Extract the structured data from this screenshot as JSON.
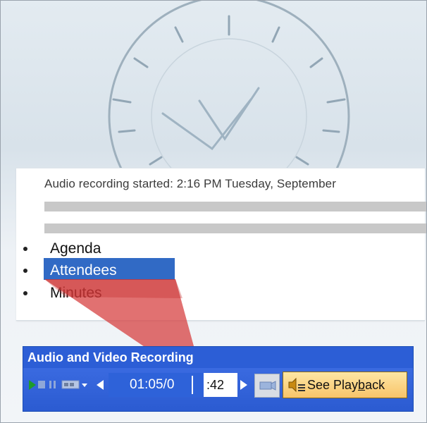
{
  "note": {
    "status_text": "Audio recording started: 2:16 PM Tuesday, September",
    "bullets": [
      {
        "label": "Agenda",
        "selected": false
      },
      {
        "label": "Attendees",
        "selected": true
      },
      {
        "label": "Minutes",
        "selected": false
      }
    ]
  },
  "toolbar": {
    "title": "Audio and Video Recording",
    "time_main": "01:05/0",
    "time_suffix": ":42",
    "playback_prefix": "See Play",
    "playback_accel": "b",
    "playback_suffix": "ack",
    "icons": {
      "play": "play-icon",
      "stop": "stop-icon",
      "pause": "pause-icon",
      "record": "record-menu-icon",
      "rewind": "rewind-icon",
      "forward": "forward-icon",
      "video": "video-icon",
      "playback": "speaker-notes-icon"
    }
  },
  "colors": {
    "selection": "#316ac5",
    "title_bar": "#2c5ed6",
    "callout": "#d63a3a",
    "playback_button": "#f8c46a"
  }
}
